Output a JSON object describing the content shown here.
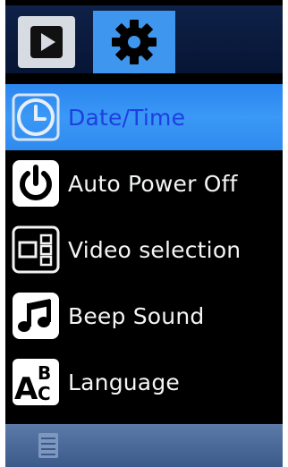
{
  "tabs": [
    {
      "icon": "play-icon",
      "active": false
    },
    {
      "icon": "gear-icon",
      "active": true
    }
  ],
  "menu": {
    "items": [
      {
        "label": "Date/Time",
        "icon": "clock-icon",
        "selected": true
      },
      {
        "label": "Auto Power Off",
        "icon": "power-icon",
        "selected": false
      },
      {
        "label": "Video selection",
        "icon": "video-selection-icon",
        "selected": false
      },
      {
        "label": "Beep Sound",
        "icon": "music-note-icon",
        "selected": false
      },
      {
        "label": "Language",
        "icon": "language-abc-icon",
        "selected": false
      }
    ]
  },
  "bottom": {
    "icon": "list-icon"
  },
  "colors": {
    "accent": "#3a98f6",
    "selected_text": "#1d3fe0",
    "text": "#f3f4f6",
    "background": "#000000"
  }
}
